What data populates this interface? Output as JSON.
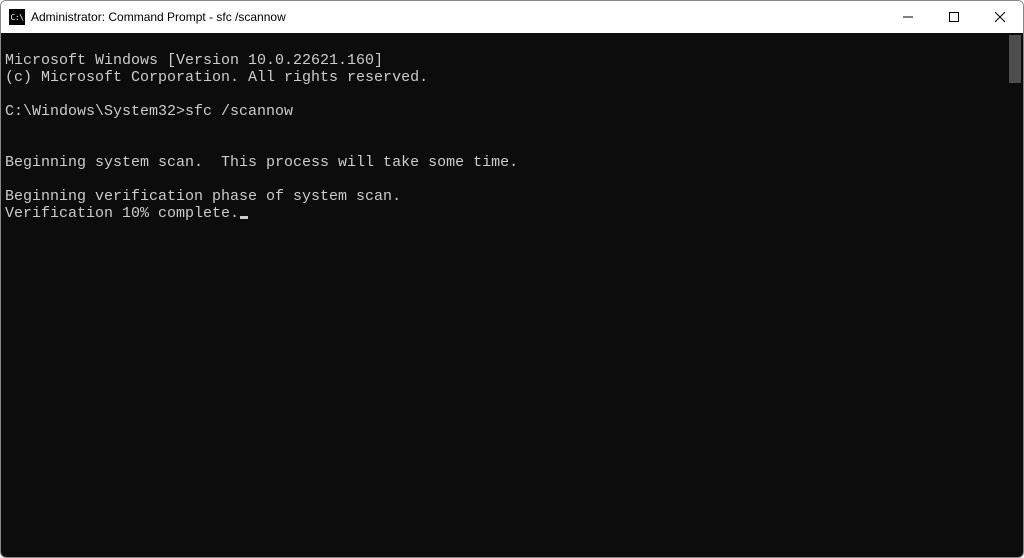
{
  "titlebar": {
    "icon_label": "C:\\",
    "title": "Administrator: Command Prompt - sfc  /scannow"
  },
  "terminal": {
    "line1": "Microsoft Windows [Version 10.0.22621.160]",
    "line2": "(c) Microsoft Corporation. All rights reserved.",
    "blank1": "",
    "prompt": "C:\\Windows\\System32>",
    "command": "sfc /scannow",
    "blank2": "",
    "line3": "Beginning system scan.  This process will take some time.",
    "blank3": "",
    "line4": "Beginning verification phase of system scan.",
    "line5": "Verification 10% complete."
  }
}
